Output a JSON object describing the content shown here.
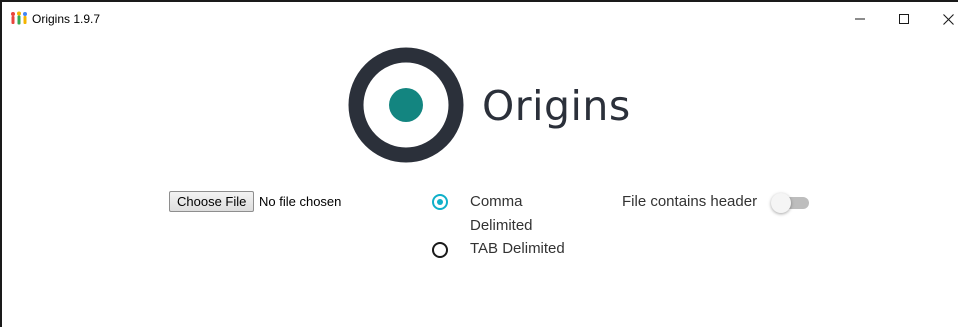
{
  "window": {
    "title": "Origins 1.9.7",
    "icon": "app-figures-icon",
    "controls": [
      "minimize-icon",
      "maximize-icon",
      "close-icon"
    ]
  },
  "logo": {
    "text": "Origins",
    "colors": {
      "ring": "#2b303a",
      "dot": "#138580",
      "text": "#2b303a"
    }
  },
  "file_input": {
    "button_label": "Choose File",
    "status": "No file chosen"
  },
  "delimiter": {
    "options": [
      {
        "label_line1": "Comma",
        "label_line2": "Delimited",
        "selected": true
      },
      {
        "label": "TAB Delimited",
        "selected": false
      }
    ],
    "accent_color": "#0fb0c9"
  },
  "header_toggle": {
    "label": "File contains header",
    "on": false
  }
}
